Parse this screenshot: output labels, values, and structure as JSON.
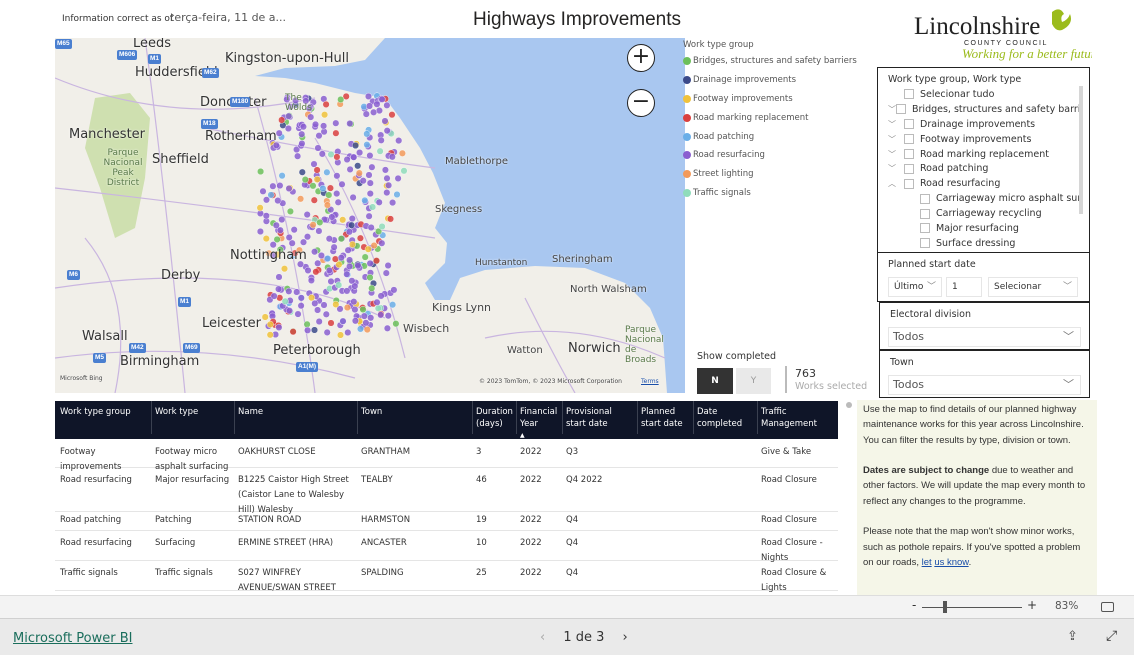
{
  "header": {
    "info_label": "Information correct as of",
    "info_date": "terça-feira, 11 de a...",
    "title": "Highways Improvements"
  },
  "logo": {
    "name": "Lincolnshire",
    "sub": "COUNTY COUNCIL",
    "tagline": "Working for a better future",
    "color": "#9bbb1c"
  },
  "map": {
    "labels": [
      "Leeds",
      "Kingston-upon-Hull",
      "Huddersfield",
      "Doncaster",
      "Manchester",
      "Rotherham",
      "Sheffield",
      "Parque Nacional Peak District",
      "The Wolds",
      "Mablethorpe",
      "Skegness",
      "Nottingham",
      "Derby",
      "Hunstanton",
      "Sheringham",
      "North Walsham",
      "Kings Lynn",
      "Wisbech",
      "Leicester",
      "Walsall",
      "Birmingham",
      "Peterborough",
      "Watton",
      "Norwich",
      "Parque Nacional de Broads"
    ],
    "roads": [
      "M65",
      "M606",
      "M1",
      "M62",
      "M180",
      "M18",
      "M6",
      "M1",
      "M42",
      "M69",
      "M5",
      "A1(M)"
    ],
    "attribution": "© 2023 TomTom, © 2023 Microsoft Corporation",
    "terms": "Terms",
    "bing": "Microsoft Bing",
    "zoom_in": "+",
    "zoom_out": "−",
    "sea_color": "#a9c7f0",
    "land_color": "#f1efe9"
  },
  "legend": {
    "title": "Work type group",
    "items": [
      {
        "label": "Bridges, structures and safety barriers",
        "color": "#6cbf5b"
      },
      {
        "label": "Drainage improvements",
        "color": "#3b4a8a"
      },
      {
        "label": "Footway improvements",
        "color": "#f0c23b"
      },
      {
        "label": "Road marking replacement",
        "color": "#d9403f"
      },
      {
        "label": "Road patching",
        "color": "#6aaee8"
      },
      {
        "label": "Road resurfacing",
        "color": "#8a5fd0"
      },
      {
        "label": "Street lighting",
        "color": "#f39a5b"
      },
      {
        "label": "Traffic signals",
        "color": "#8fdcbb"
      }
    ]
  },
  "slicer_worktype": {
    "title": "Work type group, Work type",
    "items": [
      {
        "label": "Selecionar tudo",
        "chev": ""
      },
      {
        "label": "Bridges, structures and safety barri...",
        "chev": "﹀"
      },
      {
        "label": "Drainage improvements",
        "chev": "﹀"
      },
      {
        "label": "Footway improvements",
        "chev": "﹀"
      },
      {
        "label": "Road marking replacement",
        "chev": "﹀"
      },
      {
        "label": "Road patching",
        "chev": "﹀"
      },
      {
        "label": "Road resurfacing",
        "chev": "︿"
      }
    ],
    "subitems": [
      "Carriageway micro asphalt surf...",
      "Carriageway recycling",
      "Major resurfacing",
      "Surface dressing"
    ]
  },
  "planned_start": {
    "title": "Planned start date",
    "mode": "Último",
    "value": "1",
    "unit": "Selecionar"
  },
  "electoral": {
    "title": "Electoral division",
    "value": "Todos"
  },
  "town": {
    "title": "Town",
    "value": "Todos"
  },
  "show_completed": {
    "label": "Show completed",
    "n": "N",
    "y": "Y",
    "selected": "N"
  },
  "count": {
    "value": "763",
    "label": "Works selected"
  },
  "table": {
    "headers": [
      "Work type group",
      "Work type",
      "Name",
      "Town",
      "Duration (days)",
      "Financial Year",
      "Provisional start date",
      "Planned start date",
      "Date completed",
      "Traffic Management"
    ],
    "sort_indicator": "▲",
    "rows": [
      [
        "Footway improvements",
        "Footway micro asphalt surfacing",
        "OAKHURST CLOSE",
        "GRANTHAM",
        "3",
        "2022",
        "Q3",
        "",
        "",
        "Give & Take"
      ],
      [
        "Road resurfacing",
        "Major resurfacing",
        "B1225 Caistor High Street (Caistor Lane to Walesby Hill) Walesby",
        "TEALBY",
        "46",
        "2022",
        "Q4 2022",
        "",
        "",
        "Road Closure"
      ],
      [
        "Road patching",
        "Patching",
        "STATION ROAD",
        "HARMSTON",
        "19",
        "2022",
        "Q4",
        "",
        "",
        "Road Closure"
      ],
      [
        "Road resurfacing",
        "Surfacing",
        "ERMINE STREET (HRA)",
        "ANCASTER",
        "10",
        "2022",
        "Q4",
        "",
        "",
        "Road Closure - Nights"
      ],
      [
        "Traffic signals",
        "Traffic signals",
        "S027 WINFREY AVENUE/SWAN STREET",
        "SPALDING",
        "25",
        "2022",
        "Q4",
        "",
        "",
        "Road Closure & Lights"
      ]
    ]
  },
  "info_text": {
    "p1": "Use the map to find details of our planned highway maintenance works for this year across Lincolnshire. You can filter the results by type, division or town.",
    "p2_bold": "Dates are subject to change",
    "p2_rest": " due to weather and other factors. We will update the map every month to reflect any changes to the programme.",
    "p3": "Please note that the map won't show minor works, such as pothole repairs. If you've spotted a problem on our roads, ",
    "link1": "let",
    "link2": "us know",
    "p3_end": "."
  },
  "zoom": {
    "minus": "-",
    "plus": "+",
    "level": "83%",
    "level_value": 83
  },
  "footer": {
    "brand": "Microsoft Power BI",
    "page": "1 de 3",
    "prev": "‹",
    "next": "›"
  }
}
